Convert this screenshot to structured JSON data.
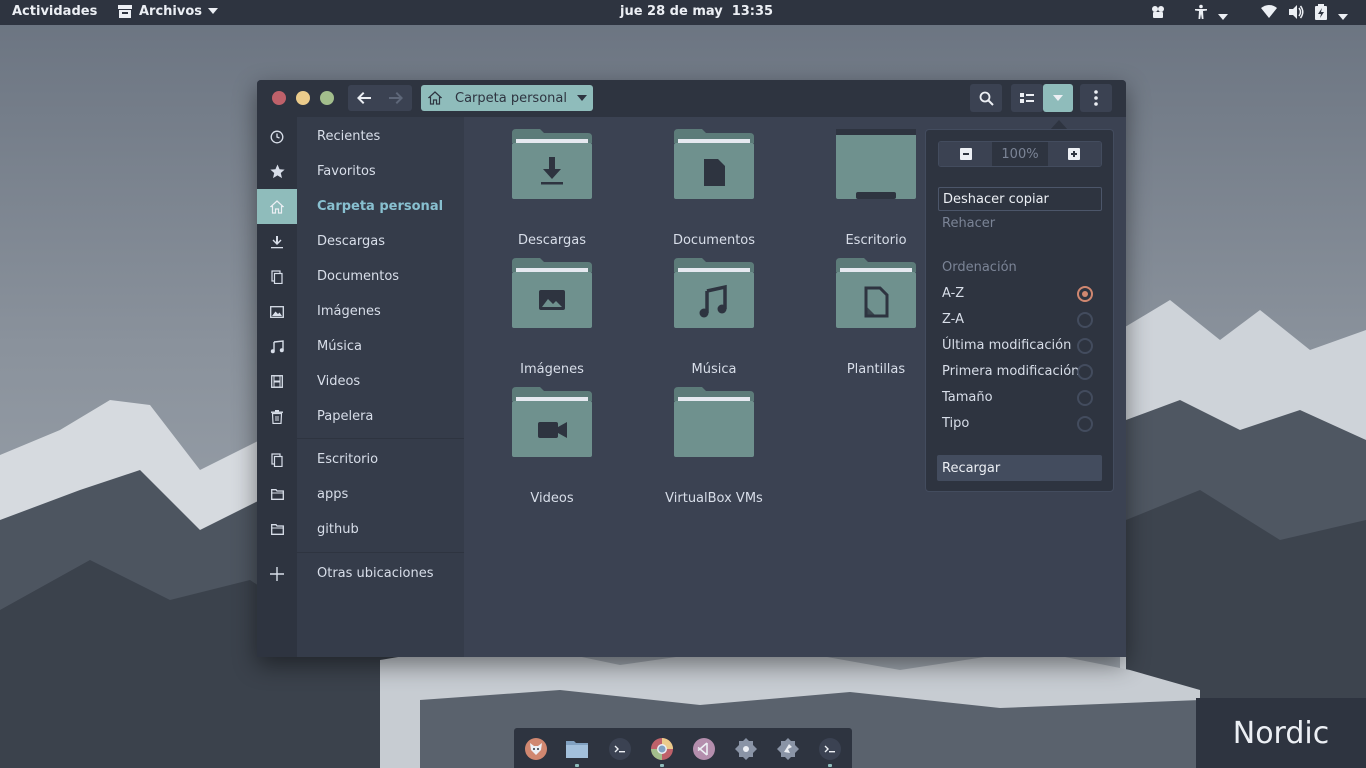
{
  "topbar": {
    "activities": "Actividades",
    "app_name": "Archivos",
    "date": "jue 28 de may",
    "time": "13:35"
  },
  "window": {
    "path_label": "Carpeta personal"
  },
  "sidebar": {
    "items": [
      {
        "label": "Recientes",
        "icon": "clock-icon"
      },
      {
        "label": "Favoritos",
        "icon": "star-icon"
      },
      {
        "label": "Carpeta personal",
        "icon": "home-icon",
        "active": true
      },
      {
        "label": "Descargas",
        "icon": "download-icon"
      },
      {
        "label": "Documentos",
        "icon": "document-icon"
      },
      {
        "label": "Imágenes",
        "icon": "image-icon"
      },
      {
        "label": "Música",
        "icon": "music-icon"
      },
      {
        "label": "Videos",
        "icon": "film-icon"
      },
      {
        "label": "Papelera",
        "icon": "trash-icon"
      }
    ],
    "bookmarks": [
      {
        "label": "Escritorio",
        "icon": "document-icon"
      },
      {
        "label": "apps",
        "icon": "folder-icon"
      },
      {
        "label": "github",
        "icon": "folder-icon"
      }
    ],
    "other": {
      "label": "Otras ubicaciones",
      "icon": "plus-icon"
    }
  },
  "files": [
    {
      "name": "Descargas",
      "emblem": "download"
    },
    {
      "name": "Documentos",
      "emblem": "document"
    },
    {
      "name": "Escritorio",
      "emblem": "desktop"
    },
    {
      "name": "Imágenes",
      "emblem": "image"
    },
    {
      "name": "Música",
      "emblem": "music"
    },
    {
      "name": "Plantillas",
      "emblem": "template"
    },
    {
      "name": "Videos",
      "emblem": "video"
    },
    {
      "name": "VirtualBox VMs",
      "emblem": "none"
    }
  ],
  "popover": {
    "zoom_value": "100%",
    "undo": "Deshacer copiar",
    "redo": "Rehacer",
    "sort_heading": "Ordenación",
    "sort_options": [
      {
        "label": "A-Z",
        "selected": true
      },
      {
        "label": "Z-A",
        "selected": false
      },
      {
        "label": "Última modificación",
        "selected": false
      },
      {
        "label": "Primera modificación",
        "selected": false
      },
      {
        "label": "Tamaño",
        "selected": false
      },
      {
        "label": "Tipo",
        "selected": false
      }
    ],
    "reload": "Recargar"
  },
  "dock": {
    "apps": [
      "firefox-icon",
      "files-icon",
      "terminal-icon",
      "chrome-icon",
      "vscode-icon",
      "settings-icon",
      "inkscape-icon",
      "terminal-icon"
    ]
  },
  "brand": "Nordic",
  "colors": {
    "accent": "#8fbcbb",
    "folder": "#6f918e",
    "radio_selected": "#d08770",
    "panel": "#2e3440",
    "window_bg": "#3b4252"
  }
}
